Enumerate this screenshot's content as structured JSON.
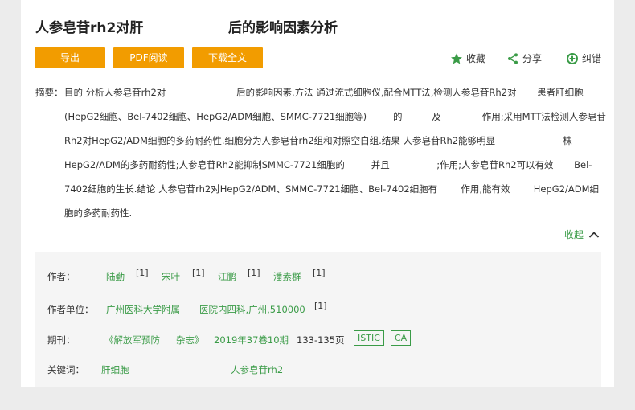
{
  "title": {
    "part1": "人参皂苷rh2对肝",
    "part2": "后的影响因素分析"
  },
  "buttons": {
    "export": "导出",
    "pdf": "PDF阅读",
    "download": "下载全文"
  },
  "actions": {
    "favorite": "收藏",
    "share": "分享",
    "report": "纠错"
  },
  "abstract": {
    "label": "摘要：",
    "lines": [
      "目的 分析人参皂苷rh2对                        后的影响因素.方法 通过流式细胞仪,配合MTT法,检测人参皂苷Rh2对       患者肝细胞",
      "(HepG2细胞、Bel-7402细胞、HepG2/ADM细胞、SMMC-7721细胞等)         的          及              作用;采用MTT法检测人参皂苷",
      "Rh2对HepG2/ADM细胞的多药耐药性.细胞分为人参皂苷rh2组和对照空白组.结果 人参皂苷Rh2能够明显                       株",
      "HepG2/ADM的多药耐药性;人参皂苷Rh2能抑制SMMC-7721细胞的         并且                ;作用;人参皂苷Rh2可以有效       Bel-",
      "7402细胞的生长.结论 人参皂苷rh2对HepG2/ADM、SMMC-7721细胞、Bel-7402细胞有        作用,能有效        HepG2/ADM细",
      "胞的多药耐药性."
    ]
  },
  "collapse": "收起",
  "meta": {
    "authors_label": "作者：",
    "authors": [
      {
        "name": "陆勤",
        "ref": "[1]"
      },
      {
        "name": "宋叶",
        "ref": "[1]"
      },
      {
        "name": "江鹏",
        "ref": "[1]"
      },
      {
        "name": "潘素群",
        "ref": "[1]"
      }
    ],
    "affiliation_label": "作者单位：",
    "affiliation_1": "广州医科大学附属",
    "affiliation_2": "医院内四科,广州,510000",
    "affiliation_ref": "[1]",
    "journal_label": "期刊：",
    "journal_name_1": "《解放军预防",
    "journal_name_2": "杂志》",
    "issue": "2019年37卷10期",
    "pages": "133-135页",
    "badges": [
      "ISTIC",
      "CA"
    ],
    "keywords_label": "关键词：",
    "keywords": [
      "肝细胞",
      "人参皂苷rh2"
    ]
  },
  "colors": {
    "accent_orange": "#f29c00",
    "link_green": "#3a9b47"
  }
}
